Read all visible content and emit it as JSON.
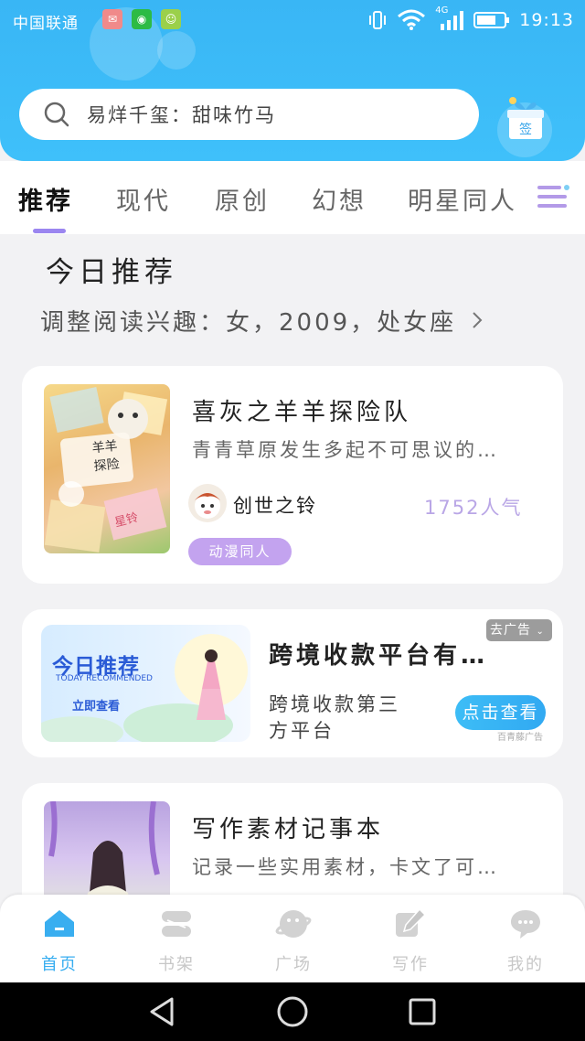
{
  "status_bar": {
    "carrier": "中国联通",
    "network": "4G",
    "time": "19:13"
  },
  "search": {
    "text": "易烊千玺：甜味竹马"
  },
  "signin": {
    "label": "签"
  },
  "tabs": [
    {
      "label": "推荐",
      "active": true
    },
    {
      "label": "现代",
      "active": false
    },
    {
      "label": "原创",
      "active": false
    },
    {
      "label": "幻想",
      "active": false
    },
    {
      "label": "明星同人",
      "active": false
    }
  ],
  "section": {
    "title": "今日推荐",
    "interest": "调整阅读兴趣：女，2009，处女座"
  },
  "books": [
    {
      "title": "喜灰之羊羊探险队",
      "desc": "青青草原发生多起不可思议的…",
      "author": "创世之铃",
      "popularity": "1752人气",
      "tag": "动漫同人",
      "cover_text": [
        "羊羊",
        "探险",
        "星铃"
      ]
    },
    {
      "title": "写作素材记事本",
      "desc": "记录一些实用素材，卡文了可…"
    }
  ],
  "ad": {
    "banner_title": "今日推荐",
    "banner_subtitle": "TODAY RECOMMENDED",
    "banner_button": "立即查看",
    "title": "跨境收款平台有…",
    "desc_line1": "跨境收款第三",
    "desc_line2": "方平台",
    "close_label": "去广告",
    "cta": "点击查看",
    "source": "百青藤广告"
  },
  "bottom_nav": [
    {
      "label": "首页",
      "icon": "home-icon",
      "active": true
    },
    {
      "label": "书架",
      "icon": "bookshelf-icon",
      "active": false
    },
    {
      "label": "广场",
      "icon": "plaza-icon",
      "active": false
    },
    {
      "label": "写作",
      "icon": "pen-icon",
      "active": false
    },
    {
      "label": "我的",
      "icon": "profile-icon",
      "active": false
    }
  ],
  "colors": {
    "header": "#3fc0fa",
    "accent": "#39aef0",
    "tab_indicator": "#9b86f0",
    "tag": "#c3a3ef",
    "popularity": "#b9a6e6"
  }
}
